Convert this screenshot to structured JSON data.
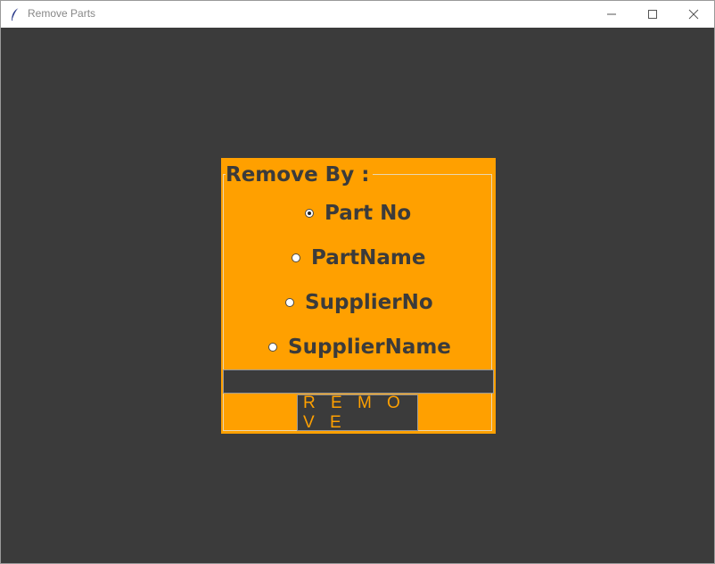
{
  "window": {
    "title": "Remove Parts"
  },
  "colors": {
    "background": "#3b3b3b",
    "accent": "#ffa000",
    "text_dark": "#3b3b3b"
  },
  "form": {
    "legend": "Remove By :",
    "options": [
      {
        "label": "Part No",
        "checked": true
      },
      {
        "label": "PartName",
        "checked": false
      },
      {
        "label": "SupplierNo",
        "checked": false
      },
      {
        "label": "SupplierName",
        "checked": false
      }
    ],
    "entry_value": "",
    "remove_label": "R E M O V E"
  }
}
